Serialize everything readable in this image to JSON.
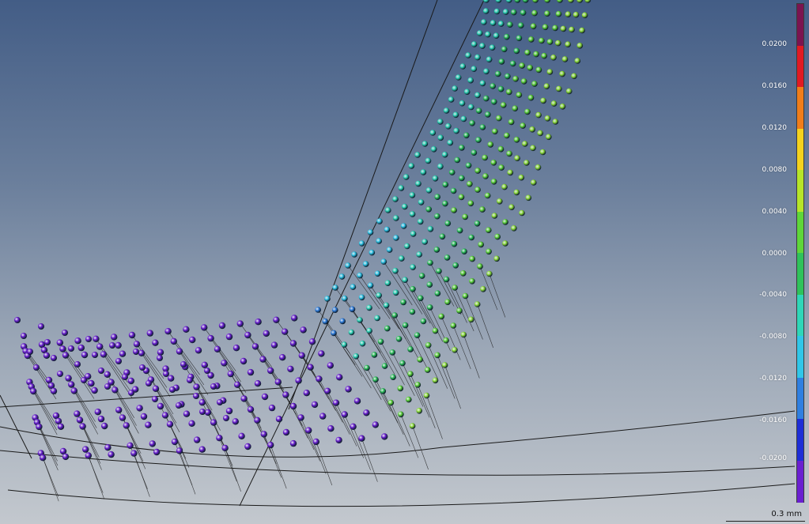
{
  "viewport": {
    "background_top": "#435d86",
    "background_bottom": "#c3c8ce"
  },
  "colorbar": {
    "labels": [
      "0.0200",
      "0.0160",
      "0.0120",
      "0.0080",
      "0.0040",
      "0.0000",
      "-0.0040",
      "-0.0080",
      "-0.0120",
      "-0.0160",
      "-0.0200"
    ],
    "colors": [
      "#7b1450",
      "#e01a23",
      "#f07d1a",
      "#f5d21e",
      "#b6e52a",
      "#5ed63a",
      "#2fc25b",
      "#2fd6b8",
      "#30c6e8",
      "#2f7fe0",
      "#1e2ed6",
      "#6a1fd0"
    ]
  },
  "scale_bar": {
    "label": "0.3 mm"
  }
}
